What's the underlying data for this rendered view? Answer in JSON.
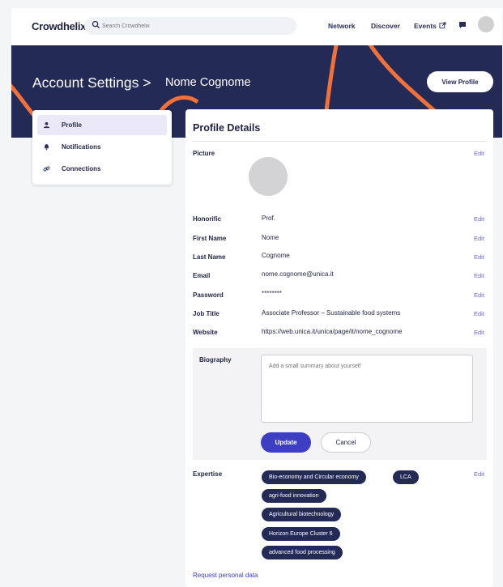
{
  "nav": {
    "logo": "Crowdhelix",
    "search_placeholder": "Search Crowdhelix",
    "links": {
      "network": "Network",
      "discover": "Discover",
      "events": "Events"
    }
  },
  "banner": {
    "title": "Account Settings >",
    "name": "Nome Cognome",
    "view_profile": "View Profile"
  },
  "sidebar": {
    "items": [
      {
        "label": "Profile",
        "icon": "user-icon",
        "active": true
      },
      {
        "label": "Notifications",
        "icon": "bell-icon",
        "active": false
      },
      {
        "label": "Connections",
        "icon": "link-icon",
        "active": false
      }
    ]
  },
  "profile": {
    "title": "Profile Details",
    "edit_label": "Edit",
    "picture_label": "Picture",
    "fields": [
      {
        "label": "Honorific",
        "value": "Prof."
      },
      {
        "label": "First Name",
        "value": "Nome"
      },
      {
        "label": "Last Name",
        "value": "Cognome"
      },
      {
        "label": "Email",
        "value": "nome.cognome@unica.it"
      },
      {
        "label": "Password",
        "value": "********"
      },
      {
        "label": "Job Title",
        "value": "Associate Professor – Sustainable food systems"
      },
      {
        "label": "Website",
        "value": "https://web.unica.it/unica/page/it/nome_cognome"
      }
    ],
    "biography": {
      "label": "Biography",
      "placeholder": "Add a small summary about yourself",
      "value": "",
      "update": "Update",
      "cancel": "Cancel"
    },
    "expertise": {
      "label": "Expertise",
      "tags": [
        "Bio-economy and Circular economy",
        "LCA",
        "agri-food innovation",
        "Agricultural biotechnology",
        "Horizon Europe Cluster 6",
        "advanced food processing"
      ]
    },
    "request_link": "Request personal data"
  },
  "colors": {
    "banner": "#232a55",
    "accent": "#3d3ec2",
    "orange": "#f0713c",
    "tag": "#232a55"
  }
}
